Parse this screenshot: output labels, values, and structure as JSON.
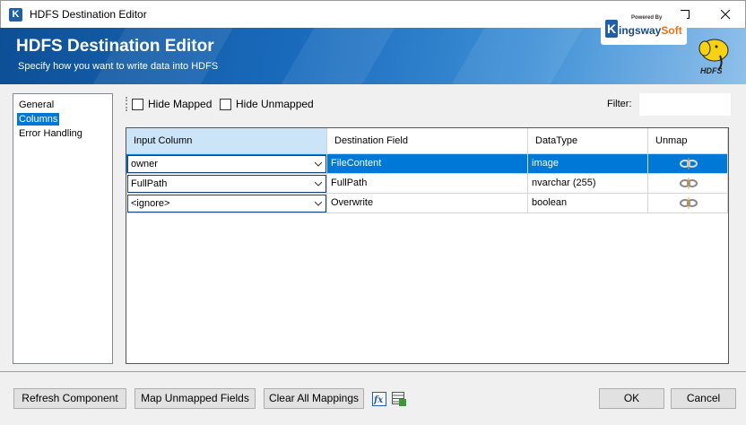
{
  "window": {
    "title": "HDFS Destination Editor",
    "app_icon": "K",
    "minimize_icon": "minimize-icon",
    "maximize_icon": "maximize-icon",
    "close_icon": "close-icon"
  },
  "banner": {
    "title": "HDFS Destination Editor",
    "subtitle": "Specify how you want to write data into HDFS",
    "logo_powered": "Powered By",
    "logo_k": "K",
    "logo_name_main": "ingsway",
    "logo_name_accent": "Soft",
    "hdfs_logo_text": "HDFS",
    "accent_color": "#1a6bbd"
  },
  "nav": {
    "items": [
      {
        "label": "General",
        "active": false
      },
      {
        "label": "Columns",
        "active": true
      },
      {
        "label": "Error Handling",
        "active": false
      }
    ]
  },
  "toolbar": {
    "hide_mapped_label": "Hide Mapped",
    "hide_unmapped_label": "Hide Unmapped",
    "filter_label": "Filter:",
    "filter_value": ""
  },
  "grid": {
    "headers": [
      "Input Column",
      "Destination Field",
      "DataType",
      "Unmap"
    ],
    "rows": [
      {
        "input": "owner",
        "destination": "FileContent",
        "datatype": "image",
        "selected": true
      },
      {
        "input": "FullPath",
        "destination": "FullPath",
        "datatype": "nvarchar (255)",
        "selected": false
      },
      {
        "input": "<ignore>",
        "destination": "Overwrite",
        "datatype": "boolean",
        "selected": false
      }
    ]
  },
  "footer": {
    "refresh_label": "Refresh Component",
    "map_unmapped_label": "Map Unmapped Fields",
    "clear_all_label": "Clear All Mappings",
    "fx_icon_label": "fx",
    "ok_label": "OK",
    "cancel_label": "Cancel"
  }
}
